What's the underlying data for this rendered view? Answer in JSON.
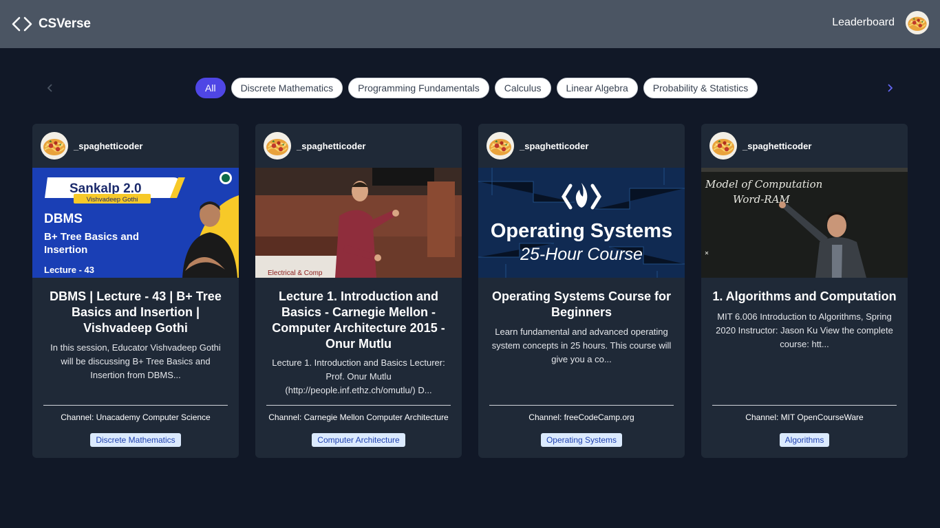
{
  "header": {
    "brand": "CSVerse",
    "leaderboard_label": "Leaderboard",
    "brand_icon": "code-brackets-icon",
    "avatar_icon": "spaghetti-avatar"
  },
  "categories": {
    "prev_icon": "chevron-left-icon",
    "next_icon": "chevron-right-icon",
    "items": [
      {
        "label": "All",
        "active": true
      },
      {
        "label": "Discrete Mathematics"
      },
      {
        "label": "Programming Fundamentals"
      },
      {
        "label": "Calculus"
      },
      {
        "label": "Linear Algebra"
      },
      {
        "label": "Probability & Statistics"
      }
    ]
  },
  "cards": [
    {
      "username": "_spaghetticoder",
      "thumbnail": {
        "brand": "Sankalp 2.0",
        "educator": "Vishvadeep Gothi",
        "subject": "DBMS",
        "topic_line1": "B+ Tree Basics and",
        "topic_line2": "Insertion",
        "lecture": "Lecture - 43"
      },
      "title": "DBMS | Lecture - 43 | B+ Tree Basics and Insertion | Vishvadeep Gothi",
      "description": "In this session, Educator Vishvadeep Gothi will be discussing B+ Tree Basics and Insertion from DBMS...",
      "channel": "Channel: Unacademy Computer Science",
      "tag": "Discrete Mathematics"
    },
    {
      "username": "_spaghetticoder",
      "thumbnail": {
        "sign_text": "Electrical & Comp"
      },
      "title": "Lecture 1. Introduction and Basics - Carnegie Mellon - Computer Architecture 2015 - Onur Mutlu",
      "description": "Lecture 1. Introduction and Basics Lecturer: Prof. Onur Mutlu (http://people.inf.ethz.ch/omutlu/) D...",
      "channel": "Channel: Carnegie Mellon Computer Architecture",
      "tag": "Computer Architecture"
    },
    {
      "username": "_spaghetticoder",
      "thumbnail": {
        "line1": "Operating Systems",
        "line2": "25-Hour Course"
      },
      "title": "Operating Systems Course for Beginners",
      "description": "Learn fundamental and advanced operating system concepts in 25 hours. This course will give you a co...",
      "channel": "Channel: freeCodeCamp.org",
      "tag": "Operating Systems"
    },
    {
      "username": "_spaghetticoder",
      "thumbnail": {
        "board_line1": "Model of Computation",
        "board_line2": "Word-RAM"
      },
      "title": "1. Algorithms and Computation",
      "description": "MIT 6.006 Introduction to Algorithms, Spring 2020 Instructor: Jason Ku View the complete course: htt...",
      "channel": "Channel: MIT OpenCourseWare",
      "tag": "Algorithms"
    }
  ]
}
